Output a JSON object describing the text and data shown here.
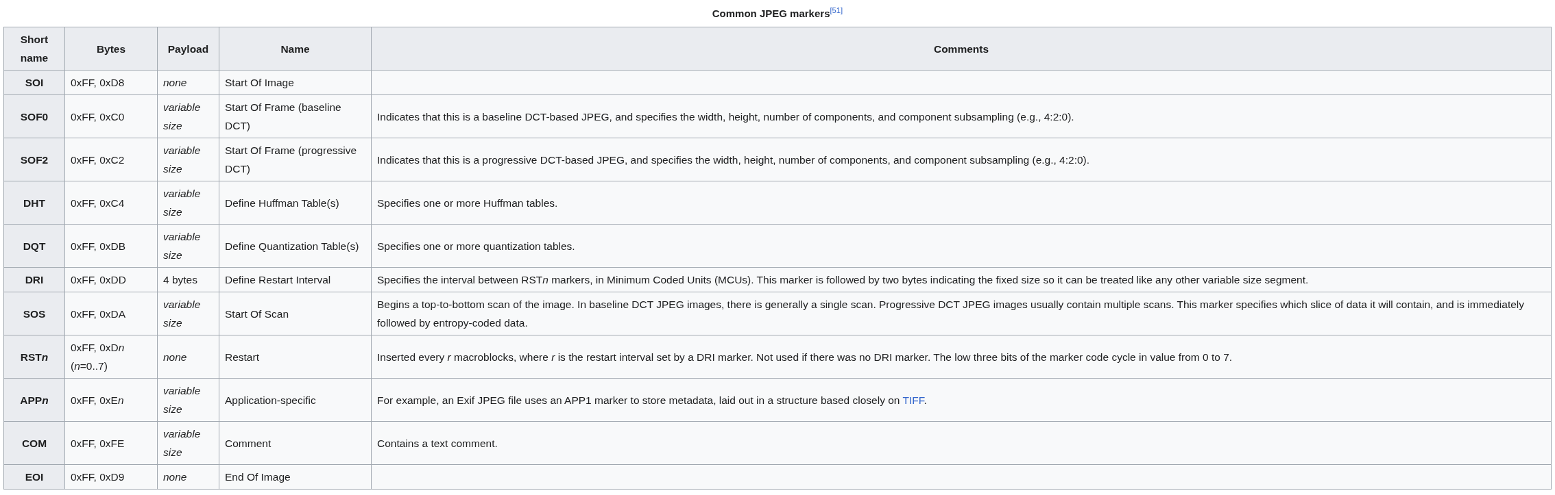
{
  "table": {
    "caption": "Common JPEG markers$^{[51]}$",
    "columns": [
      "Short name",
      "Bytes",
      "Payload",
      "Name",
      "Comments"
    ],
    "rows": [
      {
        "short": "SOI",
        "bytes": "0xFF, 0xD8",
        "payload": {
          "text": "none",
          "italic": true
        },
        "name": "Start Of Image"
      },
      {
        "short": "SOF0",
        "bytes": "0xFF, 0xC0",
        "payload": {
          "text": "variable size",
          "italic": true
        },
        "name": "Start Of Frame (baseline DCT)",
        "comment": "Indicates that this is a baseline DCT-based JPEG, and specifies the width, height, number of components, and component subsampling (e.g., 4:2:0)."
      },
      {
        "short": "SOF2",
        "bytes": "0xFF, 0xC2",
        "payload": {
          "text": "variable size",
          "italic": true
        },
        "name": "Start Of Frame (progressive DCT)",
        "comment": "Indicates that this is a progressive DCT-based JPEG, and specifies the width, height, number of components, and component subsampling (e.g., 4:2:0)."
      },
      {
        "short": "DHT",
        "bytes": "0xFF, 0xC4",
        "payload": {
          "text": "variable size",
          "italic": true
        },
        "name": "Define Huffman Table(s)",
        "comment": "Specifies one or more Huffman tables."
      },
      {
        "short": "DQT",
        "bytes": "0xFF, 0xDB",
        "payload": {
          "text": "variable size",
          "italic": true
        },
        "name": "Define Quantization Table(s)",
        "comment": "Specifies one or more quantization tables."
      },
      {
        "short": "DRI",
        "bytes": "0xFF, 0xDD",
        "payload": {
          "text": "4 bytes",
          "italic": false
        },
        "name": "Define Restart Interval",
        "comment": [
          {
            "text": "Specifies the interval between RST",
            "italic": false
          },
          {
            "text": "n",
            "italic": true
          },
          {
            "text": " markers, in Minimum Coded Units (MCUs). This marker is followed by two bytes indicating the fixed size so it can be treated like any other variable size segment.",
            "italic": false
          }
        ]
      },
      {
        "short": "SOS",
        "bytes": "0xFF, 0xDA",
        "payload": {
          "text": "variable size",
          "italic": true
        },
        "name": "Start Of Scan",
        "comment": "Begins a top-to-bottom scan of the image. In baseline DCT JPEG images, there is generally a single scan. Progressive DCT JPEG images usually contain multiple scans. This marker specifies which slice of data it will contain, and is immediately followed by entropy-coded data."
      },
      {
        "short": [
          {
            "text": "RST",
            "italic": false
          },
          {
            "text": "n",
            "italic": true
          }
        ],
        "bytes": [
          {
            "text": "0xFF, 0xD",
            "italic": false
          },
          {
            "text": "n",
            "italic": true
          },
          {
            "text": " (",
            "italic": false
          },
          {
            "text": "n",
            "italic": true
          },
          {
            "text": "=0..7)",
            "italic": false
          }
        ],
        "payload": {
          "text": "none",
          "italic": true
        },
        "name": "Restart",
        "comment": [
          {
            "text": "Inserted every ",
            "italic": false
          },
          {
            "text": "r",
            "italic": true
          },
          {
            "text": " macroblocks, where ",
            "italic": false
          },
          {
            "text": "r",
            "italic": true
          },
          {
            "text": " is the restart interval set by a DRI marker. Not used if there was no DRI marker. The low three bits of the marker code cycle in value from 0 to 7.",
            "italic": false
          }
        ]
      },
      {
        "short": [
          {
            "text": "APP",
            "italic": false
          },
          {
            "text": "n",
            "italic": true
          }
        ],
        "bytes": [
          {
            "text": "0xFF, 0xE",
            "italic": false
          },
          {
            "text": "n",
            "italic": true
          }
        ],
        "payload": {
          "text": "variable size",
          "italic": true
        },
        "name": "Application-specific",
        "comment": "For example, an Exif JPEG file uses an APP1 marker to store metadata, laid out in a structure based closely on ",
        "comment_link": "TIFF",
        "comment_after": "."
      },
      {
        "short": "COM",
        "bytes": "0xFF, 0xFE",
        "payload": {
          "text": "variable size",
          "italic": true
        },
        "name": "Comment",
        "comment": "Contains a text comment."
      },
      {
        "short": "EOI",
        "bytes": "0xFF, 0xD9",
        "payload": {
          "text": "none",
          "italic": true
        },
        "name": "End Of Image"
      }
    ]
  }
}
